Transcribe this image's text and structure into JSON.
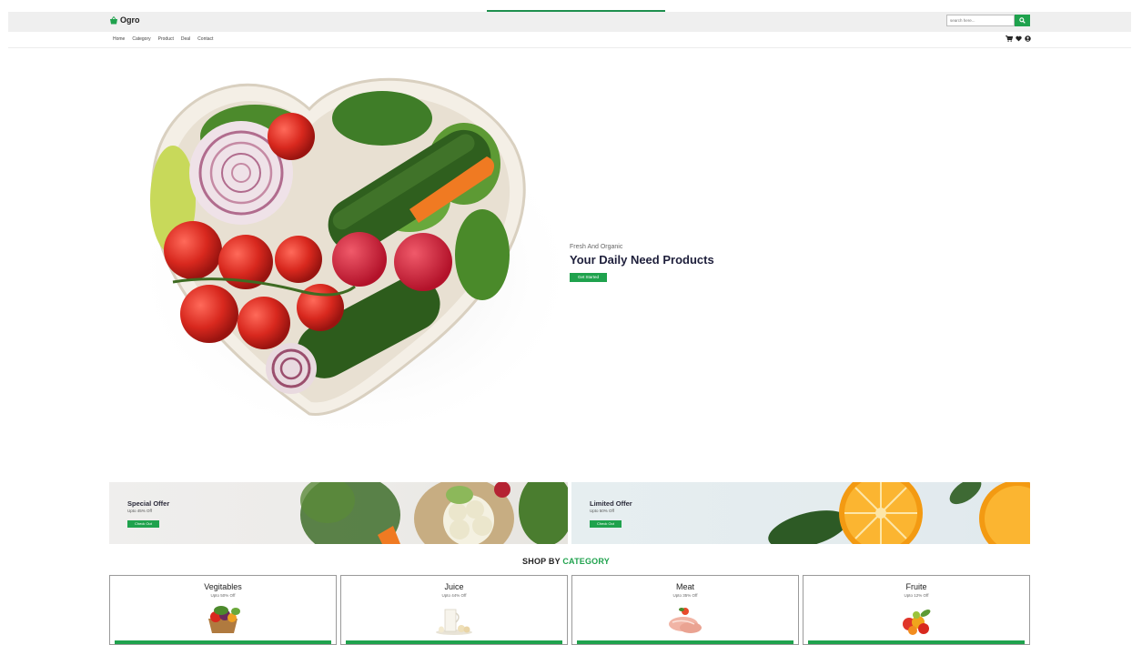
{
  "brand": {
    "name": "Ogro",
    "accent": "#1fa24d"
  },
  "search": {
    "placeholder": "search here..."
  },
  "nav": {
    "items": [
      "Home",
      "Category",
      "Product",
      "Deal",
      "Contact"
    ]
  },
  "nav_icons": [
    "cart-icon",
    "heart-icon",
    "user-icon"
  ],
  "hero": {
    "subtitle": "Fresh And Organic",
    "title": "Your Daily Need Products",
    "button": "Get Started",
    "image": "heart-shaped-vegetable-bowl"
  },
  "offers": [
    {
      "title": "Special Offer",
      "sub": "Upto 45% Off",
      "button": "Check Out",
      "image": "vegetables"
    },
    {
      "title": "Limited Offer",
      "sub": "Upto 50% Off",
      "button": "Check Out",
      "image": "oranges"
    }
  ],
  "category_section": {
    "title_main": "SHOP BY",
    "title_accent": "CATEGORY"
  },
  "categories": [
    {
      "name": "Vegitables",
      "sub": "Upto 50% Off",
      "image": "vegetable-basket"
    },
    {
      "name": "Juice",
      "sub": "Upto 44% Off",
      "image": "milk-juice"
    },
    {
      "name": "Meat",
      "sub": "Upto 35% Off",
      "image": "meat"
    },
    {
      "name": "Fruite",
      "sub": "Upto 12% Off",
      "image": "fruits"
    }
  ]
}
